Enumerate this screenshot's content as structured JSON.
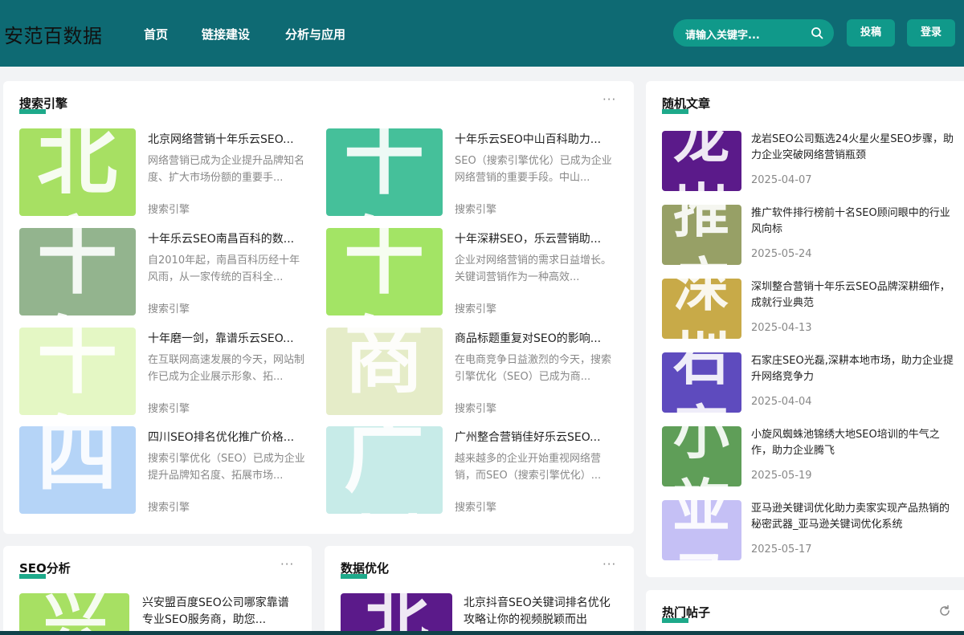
{
  "header": {
    "logo": "安范百数据",
    "nav": [
      "首页",
      "链接建设",
      "分析与应用"
    ],
    "search_placeholder": "请输入关键字...",
    "submit_label": "投稿",
    "login_label": "登录"
  },
  "search_engine": {
    "title": "搜索引擎",
    "more": "···",
    "items": [
      {
        "title": "北京网络营销十年乐云SEO...",
        "desc": "网络营销已成为企业提升品牌知名度、扩大市场份额的重要手...",
        "category": "搜索引擎",
        "thumb_color": "#a7e063",
        "thumb_char": "北京"
      },
      {
        "title": "十年乐云SEO中山百科助力...",
        "desc": "SEO（搜索引擎优化）已成为企业网络营销的重要手段。中山...",
        "category": "搜索引擎",
        "thumb_color": "#45c09a",
        "thumb_char": "十年"
      },
      {
        "title": "十年乐云SEO南昌百科的数...",
        "desc": "自2010年起，南昌百科历经十年风雨，从一家传统的百科全...",
        "category": "搜索引擎",
        "thumb_color": "#93b48e",
        "thumb_char": "十年"
      },
      {
        "title": "十年深耕SEO，乐云营销助...",
        "desc": "企业对网络营销的需求日益增长。关键词营销作为一种高效...",
        "category": "搜索引擎",
        "thumb_color": "#a3e465",
        "thumb_char": "十年"
      },
      {
        "title": "十年磨一剑，靠谱乐云SEO...",
        "desc": "在互联网高速发展的今天，网站制作已成为企业展示形象、拓...",
        "category": "搜索引擎",
        "thumb_color": "#e4f7c4",
        "thumb_char": "十年"
      },
      {
        "title": "商品标题重复对SEO的影响...",
        "desc": "在电商竞争日益激烈的今天，搜索引擎优化（SEO）已成为商...",
        "category": "搜索引擎",
        "thumb_color": "#e5ecc8",
        "thumb_char": "商品"
      },
      {
        "title": "四川SEO排名优化推广价格...",
        "desc": "搜索引擎优化（SEO）已成为企业提升品牌知名度、拓展市场...",
        "category": "搜索引擎",
        "thumb_color": "#b5d4f7",
        "thumb_char": "四川"
      },
      {
        "title": "广州整合营销佳好乐云SEO...",
        "desc": "越来越多的企业开始重视网络营销，而SEO（搜索引擎优化）...",
        "category": "搜索引擎",
        "thumb_color": "#c7ebe8",
        "thumb_char": "广州"
      }
    ]
  },
  "seo_analysis": {
    "title": "SEO分析",
    "more": "···",
    "items": [
      {
        "title": "兴安盟百度SEO公司哪家靠谱专业SEO服务商，助您...",
        "thumb_color": "#a7e063",
        "thumb_char": "兴"
      }
    ]
  },
  "data_optimization": {
    "title": "数据优化",
    "more": "···",
    "items": [
      {
        "title": "北京抖音SEO关键词排名优化攻略让你的视频脱颖而出",
        "thumb_color": "#5b1a8a",
        "thumb_char": "北"
      }
    ]
  },
  "random_articles": {
    "title": "随机文章",
    "items": [
      {
        "title": "龙岩SEO公司甄选24火星火星SEO步骤，助力企业突破网络营销瓶颈",
        "date": "2025-04-07",
        "thumb_color": "#5b1a8a",
        "thumb_char": "龙岩"
      },
      {
        "title": "推广软件排行榜前十名SEO顾问眼中的行业风向标",
        "date": "2025-05-24",
        "thumb_color": "#97a066",
        "thumb_char": "推广"
      },
      {
        "title": "深圳整合营销十年乐云SEO品牌深耕细作，成就行业典范",
        "date": "2025-04-13",
        "thumb_color": "#c8aa48",
        "thumb_char": "深圳"
      },
      {
        "title": "石家庄SEO光磊,深耕本地市场，助力企业提升网络竞争力",
        "date": "2025-04-04",
        "thumb_color": "#5e4bbe",
        "thumb_char": "石家"
      },
      {
        "title": "小旋风蜘蛛池锦绣大地SEO培训的牛气之作，助力企业腾飞",
        "date": "2025-05-19",
        "thumb_color": "#5f9e58",
        "thumb_char": "小旋"
      },
      {
        "title": "亚马逊关键词优化助力卖家实现产品热销的秘密武器_亚马逊关键词优化系统",
        "date": "2025-05-17",
        "thumb_color": "#c5c0f5",
        "thumb_char": "亚马"
      }
    ]
  },
  "hot_posts": {
    "title": "热门帖子"
  }
}
